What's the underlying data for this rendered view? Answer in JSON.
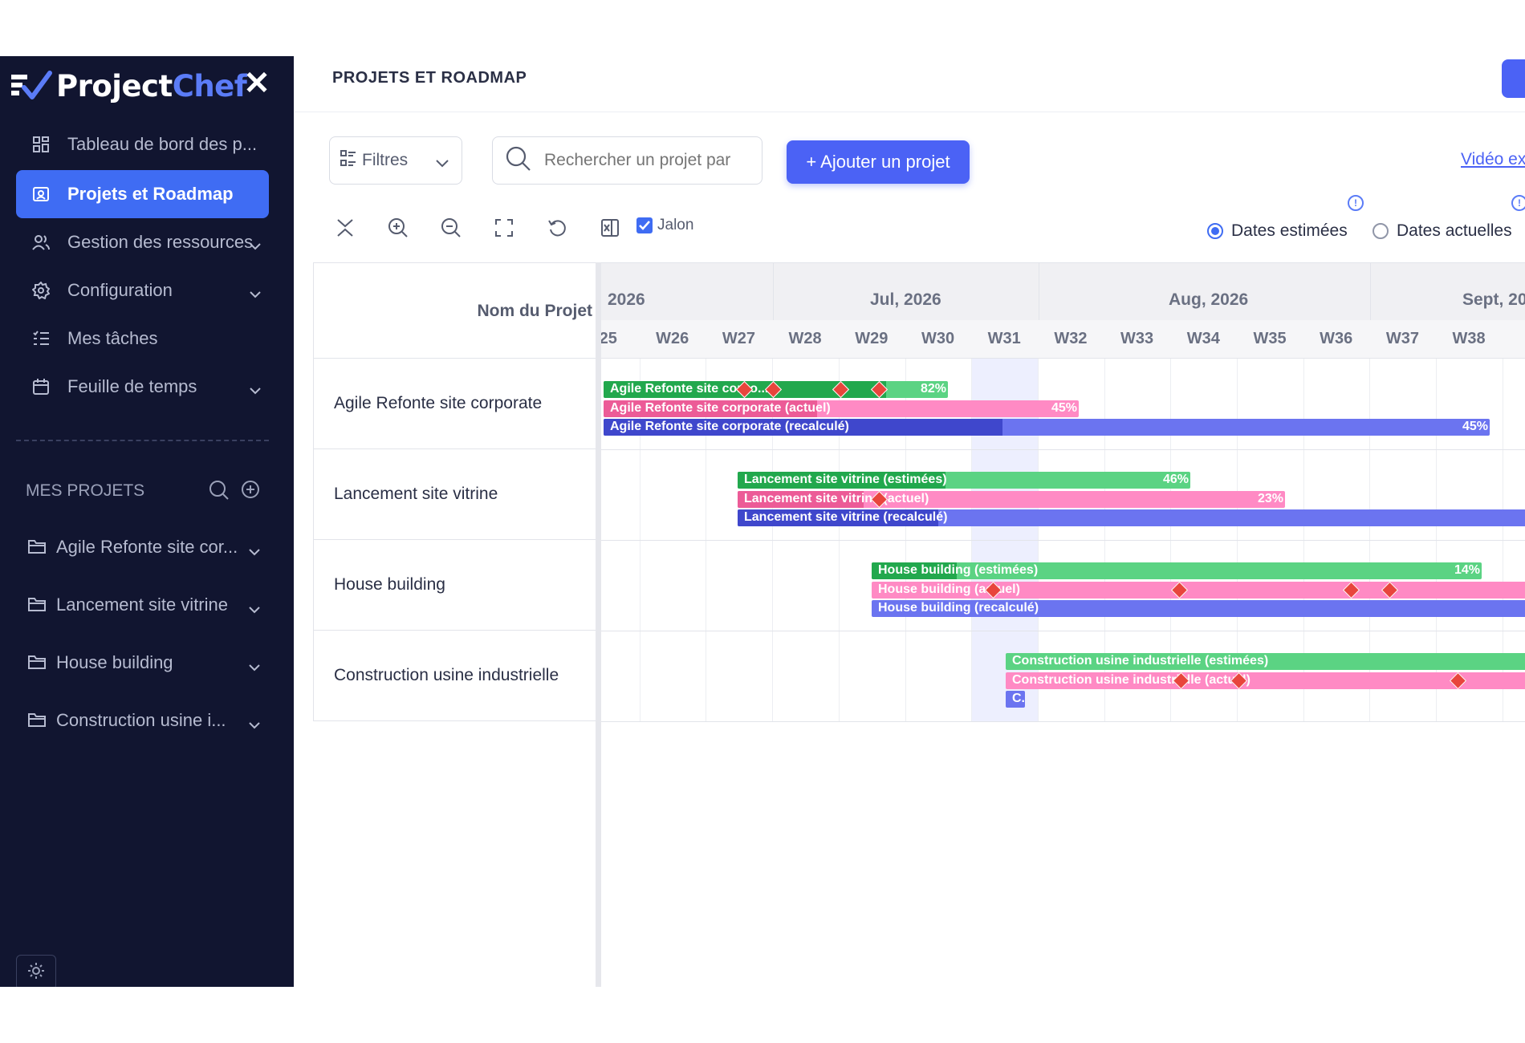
{
  "app": {
    "logo_main": "Project",
    "logo_accent": "Chef"
  },
  "sidebar": {
    "nav": [
      {
        "label": "Tableau de bord des p...",
        "icon": "dashboard-icon"
      },
      {
        "label": "Projets et Roadmap",
        "icon": "roadmap-icon",
        "active": true
      },
      {
        "label": "Gestion des ressources",
        "icon": "users-icon"
      },
      {
        "label": "Configuration",
        "icon": "gear-icon"
      },
      {
        "label": "Mes tâches",
        "icon": "tasks-icon"
      },
      {
        "label": "Feuille de temps",
        "icon": "calendar-icon"
      }
    ],
    "my_projects_title": "MES PROJETS",
    "projects": [
      {
        "label": "Agile Refonte site cor..."
      },
      {
        "label": "Lancement site vitrine"
      },
      {
        "label": "House building"
      },
      {
        "label": "Construction usine i..."
      }
    ]
  },
  "header": {
    "title": "PROJETS ET ROADMAP"
  },
  "toolbar": {
    "filters_label": "Filtres",
    "search_placeholder": "Rechercher un projet par",
    "add_label": "+ Ajouter un projet",
    "video_link": "Vidéo ex",
    "milestone_label": "Jalon",
    "milestone_checked": true,
    "radio_estimated": "Dates estimées",
    "radio_actual": "Dates actuelles",
    "selected_dates": "Dates estimées"
  },
  "gantt": {
    "name_header": "Nom du Projet",
    "months": [
      "2026",
      "Jul, 2026",
      "Aug, 2026",
      "Sept, 20"
    ],
    "weeks": [
      "/25",
      "W26",
      "W27",
      "W28",
      "W29",
      "W30",
      "W31",
      "W32",
      "W33",
      "W34",
      "W35",
      "W36",
      "W37",
      "W38",
      "W"
    ],
    "current_week": "W31",
    "projects": [
      {
        "name": "Agile Refonte site corporate",
        "bars": [
          {
            "label": "Agile Refonte site corpo...",
            "pct": "82%",
            "progress": 0.82,
            "type": "estimated"
          },
          {
            "label": "Agile Refonte site corporate (actuel)",
            "pct": "45%",
            "progress": 0.45,
            "type": "actual"
          },
          {
            "label": "Agile Refonte site corporate (recalculé)",
            "pct": "45%",
            "progress": 0.45,
            "type": "recalculated"
          }
        ]
      },
      {
        "name": "Lancement site vitrine",
        "bars": [
          {
            "label": "Lancement site vitrine (estimées)",
            "pct": "46%",
            "progress": 0.46,
            "type": "estimated"
          },
          {
            "label": "Lancement site vitrine (actuel)",
            "pct": "23%",
            "progress": 0.23,
            "type": "actual"
          },
          {
            "label": "Lancement site vitrine (recalculé)",
            "pct": "",
            "progress": 0.25,
            "type": "recalculated"
          }
        ]
      },
      {
        "name": "House building",
        "bars": [
          {
            "label": "House building (estimées)",
            "pct": "14%",
            "progress": 0.14,
            "type": "estimated"
          },
          {
            "label": "House building (actuel)",
            "pct": "",
            "progress": 0,
            "type": "actual"
          },
          {
            "label": "House building (recalculé)",
            "pct": "",
            "progress": 0,
            "type": "recalculated"
          }
        ]
      },
      {
        "name": "Construction usine industrielle",
        "bars": [
          {
            "label": "Construction usine industrielle (estimées)",
            "pct": "",
            "progress": 0,
            "type": "estimated"
          },
          {
            "label": "Construction usine industrielle (actuel)",
            "pct": "",
            "progress": 0,
            "type": "actual"
          },
          {
            "label": "C.",
            "pct": "",
            "progress": 0,
            "type": "recalculated"
          }
        ]
      }
    ]
  },
  "colors": {
    "sidebar_bg": "#111530",
    "accent": "#4b62f5",
    "estimated": "#22a84d",
    "actual": "#ec5b97",
    "recalculated": "#3f47cc",
    "milestone": "#e8453c"
  }
}
